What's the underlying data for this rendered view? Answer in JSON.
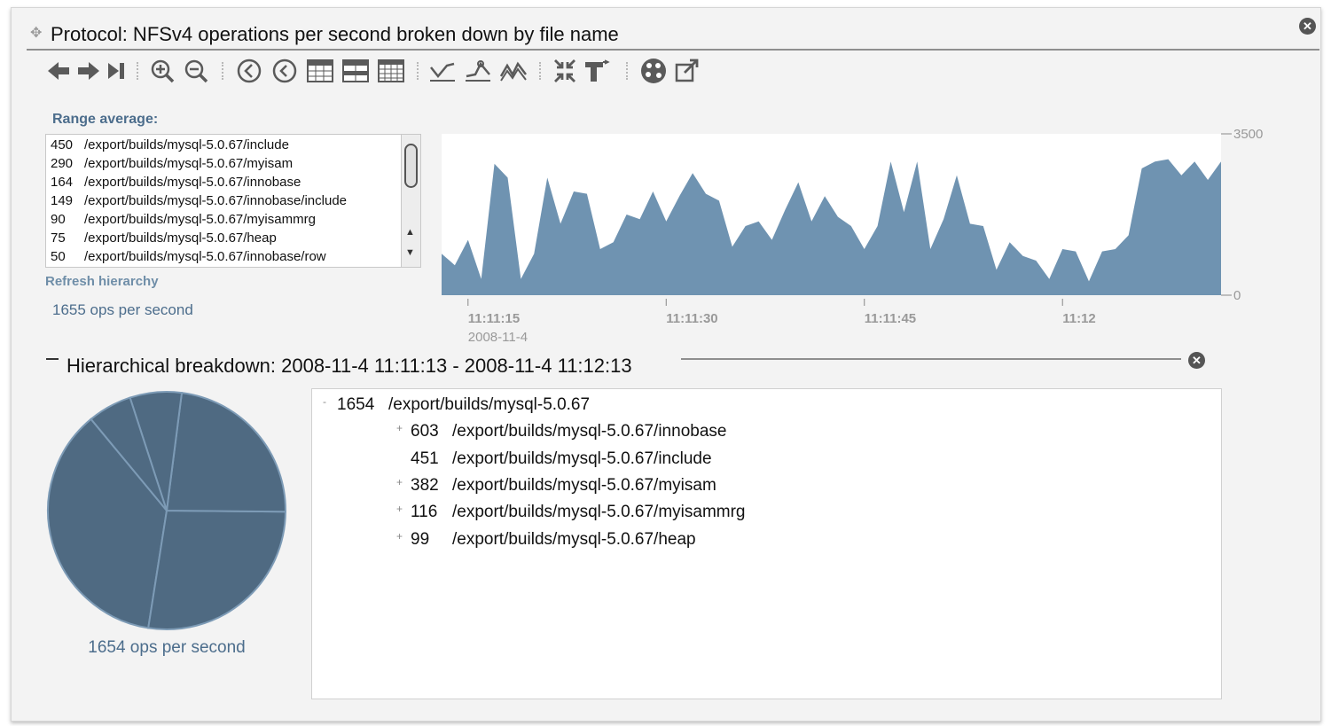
{
  "panel": {
    "title": "Protocol: NFSv4 operations per second broken down by file name",
    "close_icon": "✕"
  },
  "toolbar": {
    "icons": [
      "arrow-left-icon",
      "arrow-right-icon",
      "skip-end-icon",
      "zoom-in-icon",
      "zoom-out-icon",
      "clock-back-icon",
      "clock-forward-icon",
      "table-icon",
      "table-alt-icon",
      "table-grid-icon",
      "line-graph-icon",
      "line-graph-alt-icon",
      "area-graph-icon",
      "collapse-icon",
      "drilldown-icon",
      "palette-icon",
      "export-icon"
    ]
  },
  "range": {
    "label": "Range average:",
    "rows": [
      {
        "value": "450",
        "path": "/export/builds/mysql-5.0.67/include"
      },
      {
        "value": "290",
        "path": "/export/builds/mysql-5.0.67/myisam"
      },
      {
        "value": "164",
        "path": "/export/builds/mysql-5.0.67/innobase"
      },
      {
        "value": "149",
        "path": "/export/builds/mysql-5.0.67/innobase/include"
      },
      {
        "value": "90",
        "path": "/export/builds/mysql-5.0.67/myisammrg"
      },
      {
        "value": "75",
        "path": "/export/builds/mysql-5.0.67/heap"
      },
      {
        "value": "50",
        "path": "/export/builds/mysql-5.0.67/innobase/row"
      }
    ],
    "refresh_label": "Refresh hierarchy",
    "ops_text": "1655 ops per second"
  },
  "hierarchy": {
    "title": "Hierarchical breakdown: 2008-11-4 11:11:13 - 2008-11-4 11:12:13",
    "root": {
      "toggle": "-",
      "value": "1654",
      "path": "/export/builds/mysql-5.0.67"
    },
    "children": [
      {
        "toggle": "+",
        "value": "603",
        "path": "/export/builds/mysql-5.0.67/innobase"
      },
      {
        "toggle": "",
        "value": "451",
        "path": "/export/builds/mysql-5.0.67/include"
      },
      {
        "toggle": "+",
        "value": "382",
        "path": "/export/builds/mysql-5.0.67/myisam"
      },
      {
        "toggle": "+",
        "value": "116",
        "path": "/export/builds/mysql-5.0.67/myisammrg"
      },
      {
        "toggle": "+",
        "value": "99",
        "path": "/export/builds/mysql-5.0.67/heap"
      }
    ],
    "pie_ops_text": "1654 ops per second"
  },
  "chart_data": [
    {
      "type": "area",
      "title": "",
      "ylim": [
        0,
        3500
      ],
      "yticks": [
        "3500",
        "0"
      ],
      "xticks": [
        {
          "label": "11:11:15",
          "sub": "2008-11-4",
          "t": 2
        },
        {
          "label": "11:11:30",
          "sub": "",
          "t": 17
        },
        {
          "label": "11:11:45",
          "sub": "",
          "t": 32
        },
        {
          "label": "11:12",
          "sub": "",
          "t": 47
        }
      ],
      "xlim": [
        0,
        59
      ],
      "grid": false,
      "color": "#6f93b1",
      "values": [
        900,
        650,
        1200,
        350,
        2850,
        2550,
        350,
        900,
        2550,
        1550,
        2250,
        2200,
        1000,
        1150,
        1750,
        1650,
        2250,
        1600,
        2150,
        2650,
        2200,
        2050,
        1050,
        1500,
        1600,
        1200,
        1850,
        2450,
        1600,
        2150,
        1700,
        1500,
        1000,
        1500,
        2900,
        1800,
        2900,
        1000,
        1650,
        2600,
        1550,
        1500,
        550,
        1150,
        850,
        750,
        350,
        1000,
        950,
        300,
        950,
        1000,
        1300,
        2750,
        2900,
        2950,
        2600,
        2900,
        2500,
        2900
      ],
      "series": [
        {
          "name": "",
          "values": []
        }
      ]
    },
    {
      "type": "pie",
      "title": "",
      "labels": [
        "/export/builds/mysql-5.0.67/innobase",
        "/export/builds/mysql-5.0.67/include",
        "/export/builds/mysql-5.0.67/myisam",
        "/export/builds/mysql-5.0.67/myisammrg",
        "/export/builds/mysql-5.0.67/heap"
      ],
      "values": [
        603,
        451,
        382,
        116,
        99
      ],
      "color": "#4f6a82"
    }
  ]
}
